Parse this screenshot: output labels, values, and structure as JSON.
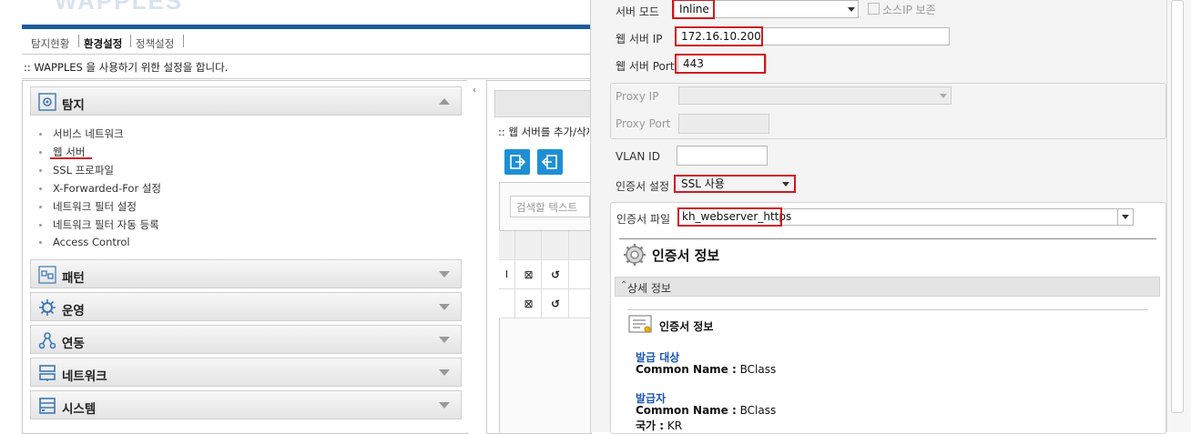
{
  "app": {
    "logo_text": "WAPPLES"
  },
  "tabs": [
    {
      "label": "탐지현황"
    },
    {
      "label": "환경설정"
    },
    {
      "label": "정책설정"
    }
  ],
  "page_description": ":: WAPPLES 을 사용하기 위한 설정을 합니다.",
  "menu": {
    "sections": [
      {
        "label": "탐지",
        "expanded": true,
        "icon": "detect-icon"
      },
      {
        "label": "패턴",
        "expanded": false,
        "icon": "pattern-icon"
      },
      {
        "label": "운영",
        "expanded": false,
        "icon": "operation-icon"
      },
      {
        "label": "연동",
        "expanded": false,
        "icon": "integration-icon"
      },
      {
        "label": "네트워크",
        "expanded": false,
        "icon": "network-icon"
      },
      {
        "label": "시스템",
        "expanded": false,
        "icon": "system-icon"
      }
    ],
    "detect_items": [
      {
        "label": "서비스 네트워크"
      },
      {
        "label": "웹 서버"
      },
      {
        "label": "SSL 프로파일"
      },
      {
        "label": "X-Forwarded-For 설정"
      },
      {
        "label": "네트워크 필터 설정"
      },
      {
        "label": "네트워크 필터 자동 등록"
      },
      {
        "label": "Access Control"
      }
    ]
  },
  "middle": {
    "description": ":: 웹 서버를 추가/삭제합니다.",
    "search_placeholder": "검색할 텍스트",
    "row_marker": "I"
  },
  "form": {
    "server_mode_label": "서버 모드",
    "server_mode_value": "Inline",
    "source_ip_label": "소스IP 보존",
    "web_server_ip_label": "웹 서버 IP",
    "web_server_ip_value": "172.16.10.200",
    "web_server_port_label": "웹 서버 Port",
    "web_server_port_value": "443",
    "proxy_ip_label": "Proxy IP",
    "proxy_port_label": "Proxy Port",
    "vlan_id_label": "VLAN ID",
    "cert_setting_label": "인증서 설정",
    "cert_setting_value": "SSL 사용",
    "cert_file_label": "인증서 파일",
    "cert_file_value": "kh_webserver_https"
  },
  "cert_info": {
    "title": "인증서 정보",
    "detail_header": "상세 정보",
    "info_title": "인증서 정보",
    "subject_heading": "발급 대상",
    "subject_cn_label": "Common Name :",
    "subject_cn_value": "BClass",
    "issuer_heading": "발급자",
    "issuer_cn_label": "Common Name :",
    "issuer_cn_value": "BClass",
    "country_label": "국가 :",
    "country_value": "KR"
  },
  "colors": {
    "highlight_red": "#d0191f",
    "accent_blue": "#1e8fd4",
    "brand_bar": "#1d5c9a"
  }
}
